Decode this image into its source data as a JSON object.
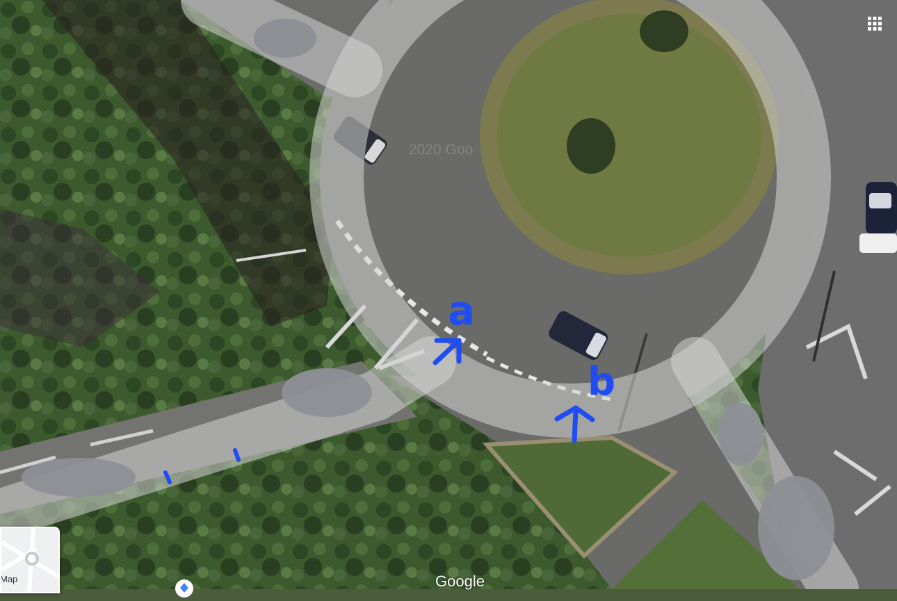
{
  "map": {
    "watermark": "2020 Goo",
    "attribution_logo": "Google",
    "minimap_label": "Map",
    "markers": [
      {
        "label": "a"
      },
      {
        "label": "b"
      }
    ],
    "colors": {
      "annotation_ink": "#1f4df2",
      "highlight_overlay": "#d4d4d4",
      "redaction": "#8d8f96"
    },
    "controls": {
      "grid_icon": "apps-grid-icon",
      "pegman_icon": "street-view-pegman-icon"
    }
  }
}
